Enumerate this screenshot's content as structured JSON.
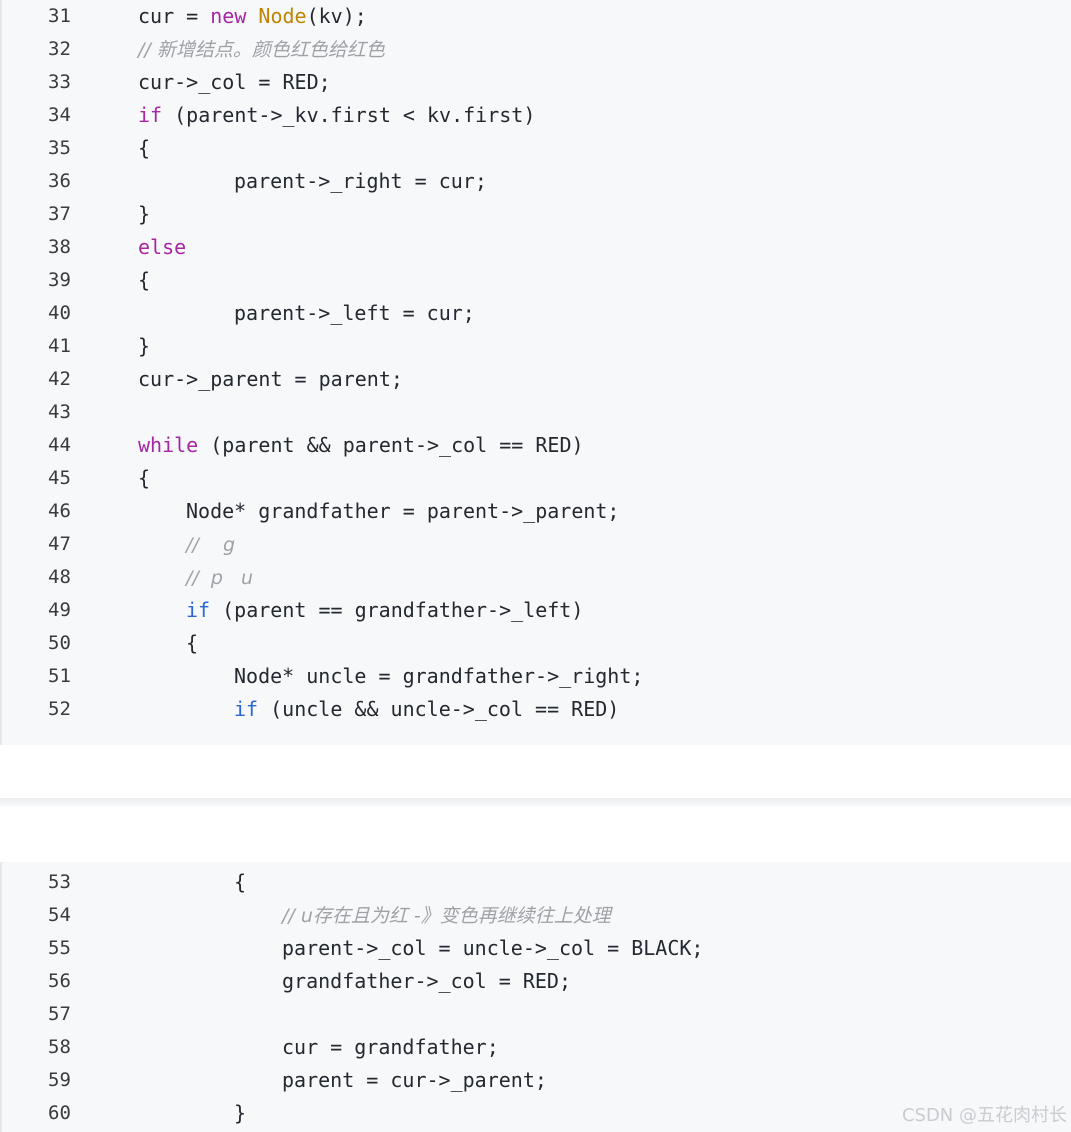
{
  "block1": {
    "lines": [
      {
        "num": "31",
        "indent": 1,
        "tokens": [
          {
            "t": "cur = ",
            "c": ""
          },
          {
            "t": "new ",
            "c": "kw"
          },
          {
            "t": "Node",
            "c": "ty"
          },
          {
            "t": "(kv);",
            "c": ""
          }
        ]
      },
      {
        "num": "32",
        "indent": 1,
        "tokens": [
          {
            "t": "// 新增结点。颜色红色给红色",
            "c": "cm"
          }
        ]
      },
      {
        "num": "33",
        "indent": 1,
        "tokens": [
          {
            "t": "cur->_col = RED;",
            "c": ""
          }
        ]
      },
      {
        "num": "34",
        "indent": 1,
        "tokens": [
          {
            "t": "if",
            "c": "kw"
          },
          {
            "t": " (parent->_kv.first < kv.first)",
            "c": ""
          }
        ]
      },
      {
        "num": "35",
        "indent": 1,
        "tokens": [
          {
            "t": "{",
            "c": ""
          }
        ]
      },
      {
        "num": "36",
        "indent": 3,
        "tokens": [
          {
            "t": "parent->_right = cur;",
            "c": ""
          }
        ]
      },
      {
        "num": "37",
        "indent": 1,
        "tokens": [
          {
            "t": "}",
            "c": ""
          }
        ]
      },
      {
        "num": "38",
        "indent": 1,
        "tokens": [
          {
            "t": "else",
            "c": "kw"
          }
        ]
      },
      {
        "num": "39",
        "indent": 1,
        "tokens": [
          {
            "t": "{",
            "c": ""
          }
        ]
      },
      {
        "num": "40",
        "indent": 3,
        "tokens": [
          {
            "t": "parent->_left = cur;",
            "c": ""
          }
        ]
      },
      {
        "num": "41",
        "indent": 1,
        "tokens": [
          {
            "t": "}",
            "c": ""
          }
        ]
      },
      {
        "num": "42",
        "indent": 1,
        "tokens": [
          {
            "t": "cur->_parent = parent;",
            "c": ""
          }
        ]
      },
      {
        "num": "43",
        "indent": 1,
        "tokens": []
      },
      {
        "num": "44",
        "indent": 1,
        "tokens": [
          {
            "t": "while",
            "c": "kw"
          },
          {
            "t": " (parent && parent->_col == RED)",
            "c": ""
          }
        ]
      },
      {
        "num": "45",
        "indent": 1,
        "tokens": [
          {
            "t": "{",
            "c": ""
          }
        ]
      },
      {
        "num": "46",
        "indent": 2,
        "tokens": [
          {
            "t": "Node* grandfather = parent->_parent;",
            "c": ""
          }
        ]
      },
      {
        "num": "47",
        "indent": 2,
        "tokens": [
          {
            "t": "//    g",
            "c": "cm"
          }
        ]
      },
      {
        "num": "48",
        "indent": 2,
        "tokens": [
          {
            "t": "//  p   u",
            "c": "cm"
          }
        ]
      },
      {
        "num": "49",
        "indent": 2,
        "tokens": [
          {
            "t": "if",
            "c": "kw-blue"
          },
          {
            "t": " (parent == grandfather->_left)",
            "c": ""
          }
        ]
      },
      {
        "num": "50",
        "indent": 2,
        "tokens": [
          {
            "t": "{",
            "c": ""
          }
        ]
      },
      {
        "num": "51",
        "indent": 3,
        "tokens": [
          {
            "t": "Node* uncle = grandfather->_right;",
            "c": ""
          }
        ]
      },
      {
        "num": "52",
        "indent": 3,
        "tokens": [
          {
            "t": "if",
            "c": "kw-blue"
          },
          {
            "t": " (uncle && uncle->_col == RED)",
            "c": ""
          }
        ]
      }
    ]
  },
  "block2": {
    "lines": [
      {
        "num": "53",
        "indent": 3,
        "tokens": [
          {
            "t": "{",
            "c": ""
          }
        ]
      },
      {
        "num": "54",
        "indent": 4,
        "tokens": [
          {
            "t": "// u存在且为红 -》变色再继续往上处理",
            "c": "cm"
          }
        ]
      },
      {
        "num": "55",
        "indent": 4,
        "tokens": [
          {
            "t": "parent->_col = uncle->_col = BLACK;",
            "c": ""
          }
        ]
      },
      {
        "num": "56",
        "indent": 4,
        "tokens": [
          {
            "t": "grandfather->_col = RED;",
            "c": ""
          }
        ]
      },
      {
        "num": "57",
        "indent": 4,
        "tokens": []
      },
      {
        "num": "58",
        "indent": 4,
        "tokens": [
          {
            "t": "cur = grandfather;",
            "c": ""
          }
        ]
      },
      {
        "num": "59",
        "indent": 4,
        "tokens": [
          {
            "t": "parent = cur->_parent;",
            "c": ""
          }
        ]
      },
      {
        "num": "60",
        "indent": 3,
        "tokens": [
          {
            "t": "}",
            "c": ""
          }
        ]
      }
    ]
  },
  "watermark": "CSDN @五花肉村长"
}
